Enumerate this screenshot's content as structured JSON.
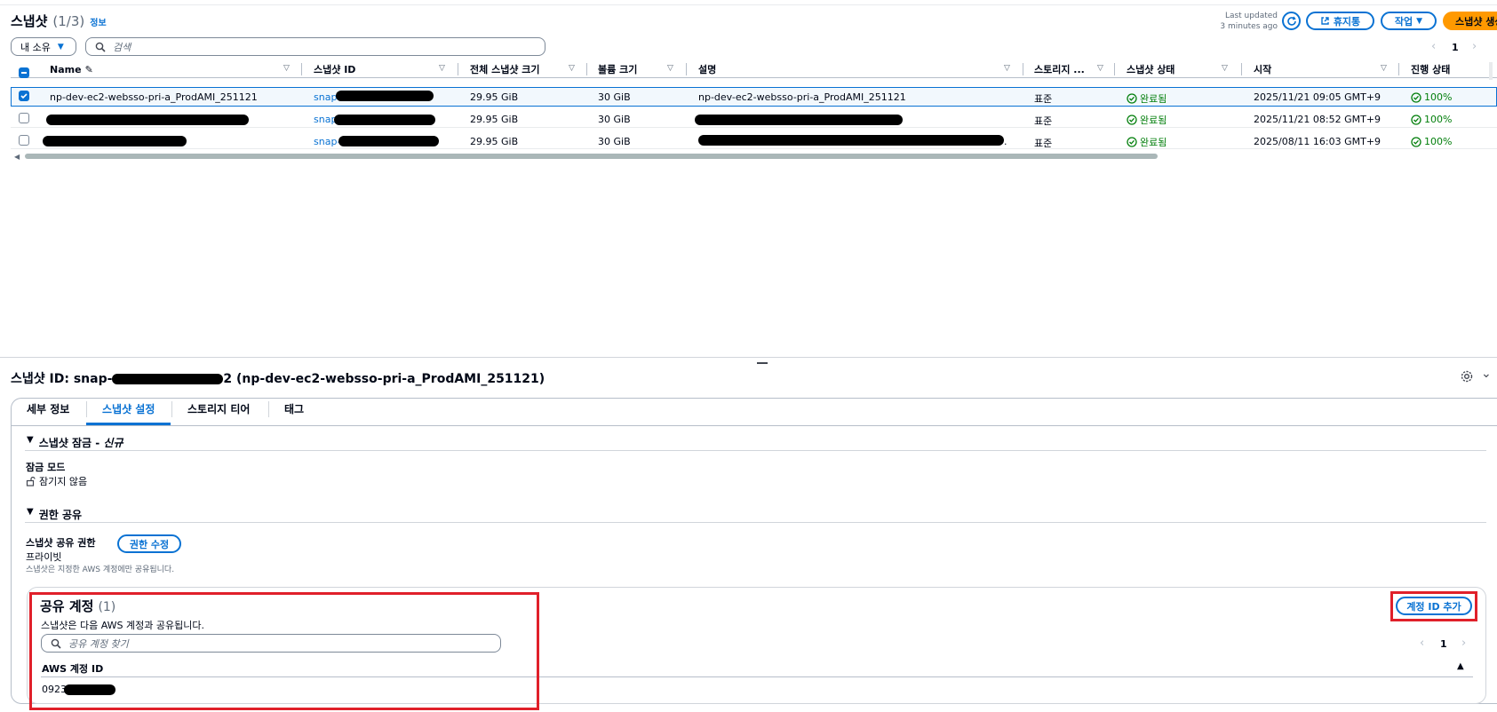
{
  "list": {
    "title": "스냅샷",
    "count": "(1/3)",
    "info": "정보",
    "last_updated_line1": "Last updated",
    "last_updated_line2": "3 minutes ago",
    "recycle_bin": "휴지통",
    "actions": "작업",
    "create": "스냅샷 생성",
    "owner_filter": "내 소유",
    "search_placeholder": "검색",
    "page": "1"
  },
  "table": {
    "columns": [
      "Name",
      "스냅샷 ID",
      "전체 스냅샷 크기",
      "볼륨 크기",
      "설명",
      "스토리지 ...",
      "스냅샷 상태",
      "시작",
      "진행 상태"
    ],
    "rows": [
      {
        "name": "np-dev-ec2-websso-pri-a_ProdAMI_251121",
        "id": "snap-",
        "full_size": "29.95 GiB",
        "vol_size": "30 GiB",
        "desc": "np-dev-ec2-websso-pri-a_ProdAMI_251121",
        "storage": "표준",
        "state": "완료됨",
        "started": "2025/11/21 09:05 GMT+9",
        "progress": "100%",
        "selected": true
      },
      {
        "name": "",
        "id": "snap-",
        "full_size": "29.95 GiB",
        "vol_size": "30 GiB",
        "desc": "",
        "storage": "표준",
        "state": "완료됨",
        "started": "2025/11/21 08:52 GMT+9",
        "progress": "100%",
        "selected": false
      },
      {
        "name": "",
        "id": "snap-",
        "full_size": "29.95 GiB",
        "vol_size": "30 GiB",
        "desc": ".",
        "storage": "표준",
        "state": "완료됨",
        "started": "2025/08/11 16:03 GMT+9",
        "progress": "100%",
        "selected": false
      }
    ]
  },
  "detail": {
    "title_prefix": "스냅샷 ID: snap-",
    "title_suffix": "2 (np-dev-ec2-websso-pri-a_ProdAMI_251121)",
    "tabs": [
      "세부 정보",
      "스냅샷 설정",
      "스토리지 티어",
      "태그"
    ],
    "lock_section": "스냅샷 잠금 - ",
    "lock_section_new": "신규",
    "lock_mode_label": "잠금 모드",
    "lock_mode_value": "잠기지 않음",
    "perm_section": "권한 공유",
    "share_perm_label": "스냅샷 공유 권한",
    "share_perm_value": "프라이빗",
    "share_perm_desc": "스냅샷은 지정한 AWS 계정에만 공유됩니다.",
    "edit_perm": "권한 수정",
    "shared_title": "공유 계정",
    "shared_count": "(1)",
    "shared_desc": "스냅샷은 다음 AWS 계정과 공유됩니다.",
    "shared_search_placeholder": "공유 계정 찾기",
    "add_account": "계정 ID 추가",
    "shared_page": "1",
    "account_col": "AWS 계정 ID",
    "account_value": "0923"
  },
  "colors": {
    "accent": "#0972d3",
    "primary": "#ff9900",
    "success": "#037f0c",
    "highlight": "#e0202a"
  }
}
